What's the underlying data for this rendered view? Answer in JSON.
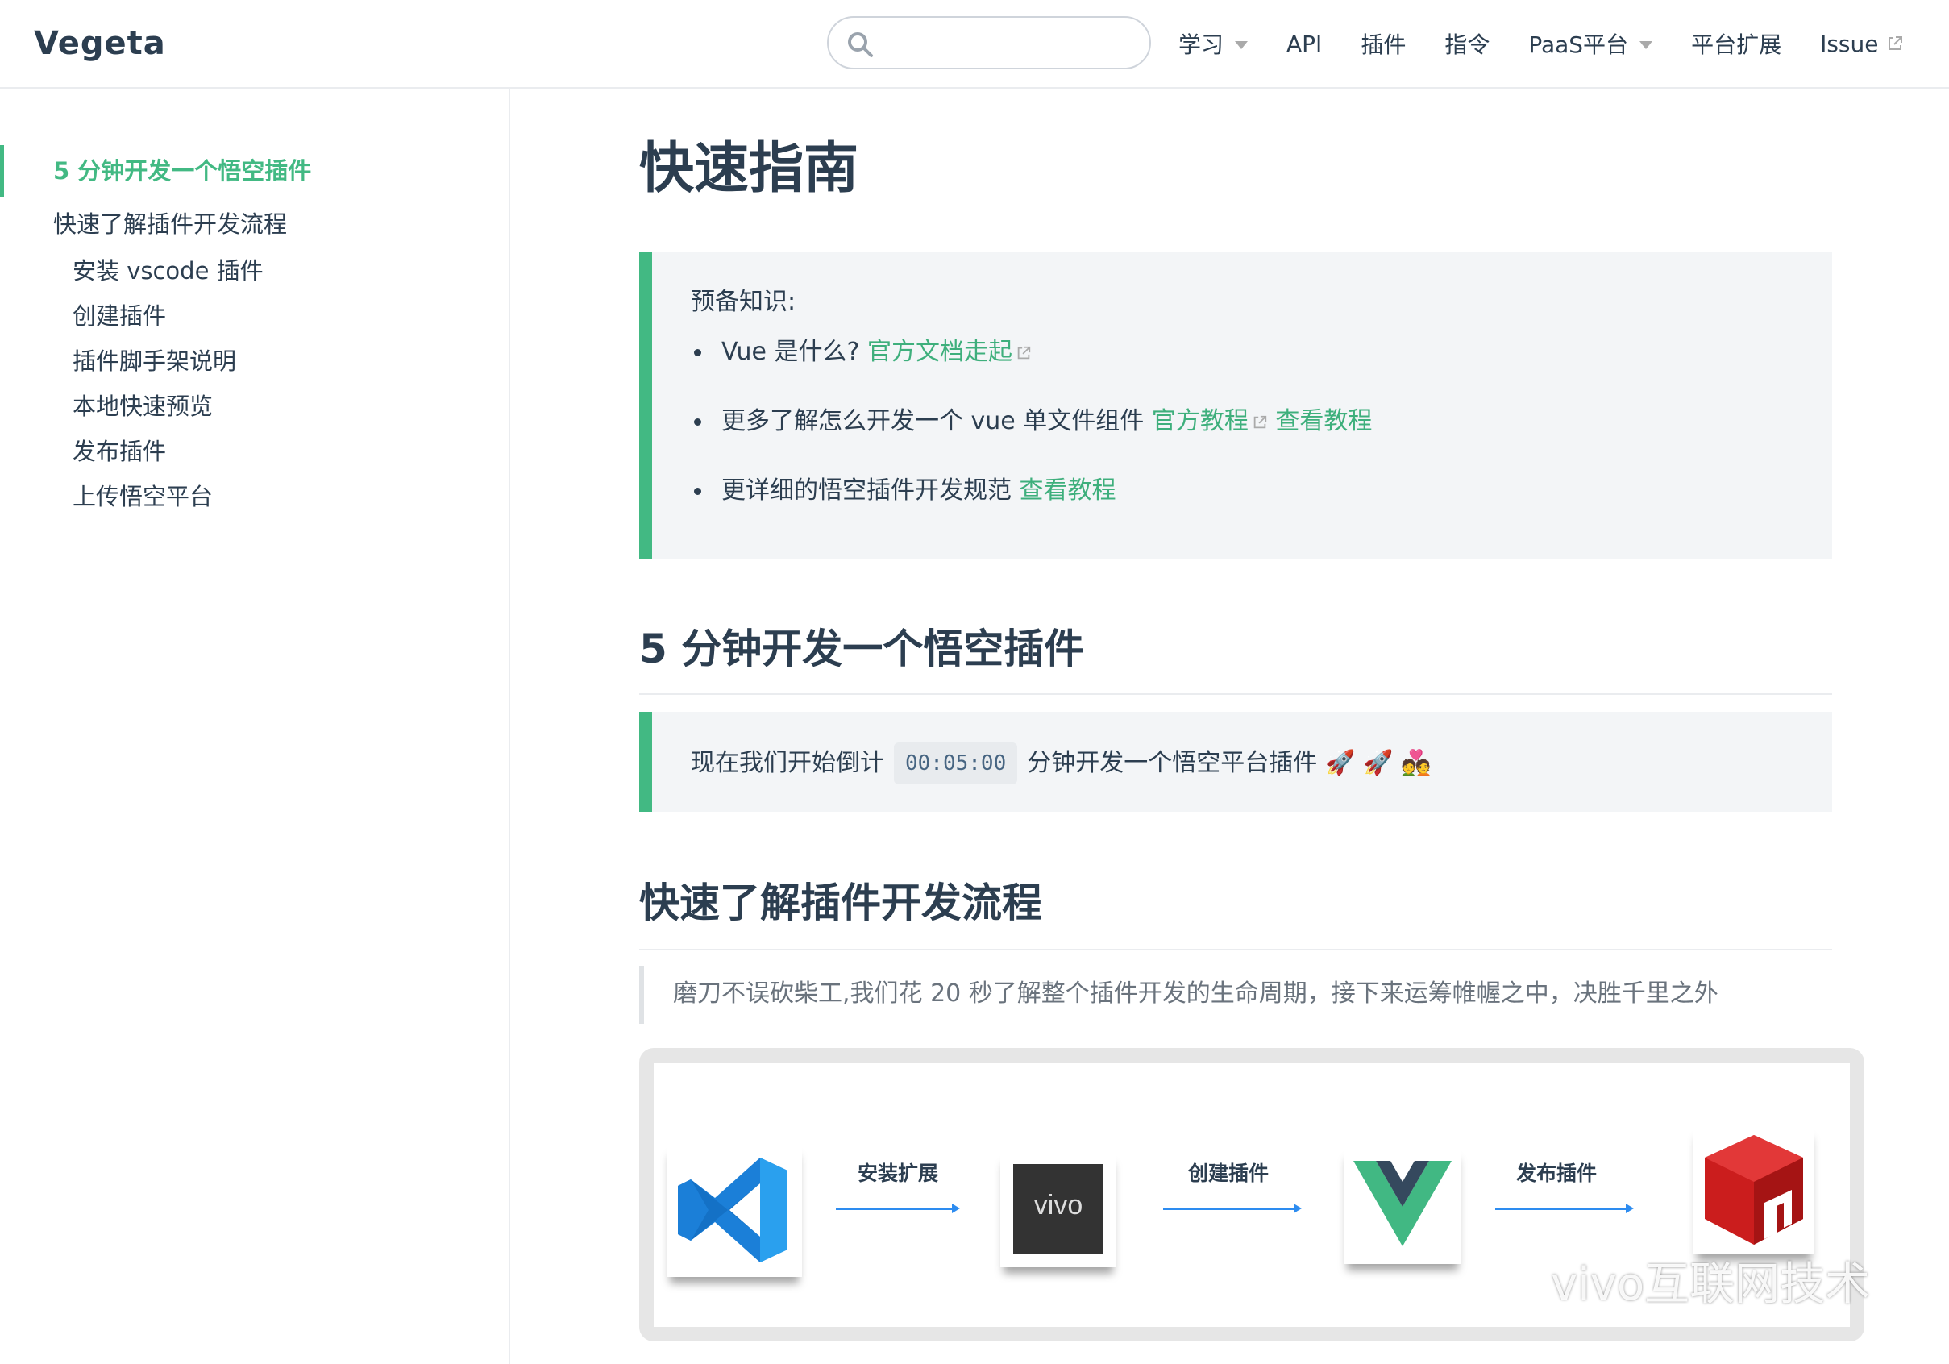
{
  "navbar": {
    "site_title": "Vegeta",
    "search": {
      "placeholder": ""
    },
    "links": [
      {
        "label": "学习",
        "dropdown": true
      },
      {
        "label": "API"
      },
      {
        "label": "插件"
      },
      {
        "label": "指令"
      },
      {
        "label": "PaaS平台",
        "dropdown": true
      },
      {
        "label": "平台扩展"
      },
      {
        "label": "Issue",
        "external": true
      }
    ]
  },
  "sidebar": {
    "items": [
      {
        "label": "5 分钟开发一个悟空插件",
        "active": true
      },
      {
        "label": "快速了解插件开发流程"
      },
      {
        "label": "安装 vscode 插件"
      },
      {
        "label": "创建插件"
      },
      {
        "label": "插件脚手架说明"
      },
      {
        "label": "本地快速预览"
      },
      {
        "label": "发布插件"
      },
      {
        "label": "上传悟空平台"
      }
    ]
  },
  "main": {
    "page_title": "快速指南",
    "prereq": {
      "title": "预备知识:",
      "items": [
        {
          "text": "Vue 是什么? ",
          "link1": "官方文档走起"
        },
        {
          "text": "更多了解怎么开发一个 vue 单文件组件 ",
          "link1": "官方教程",
          "link2": "查看教程"
        },
        {
          "text": "更详细的悟空插件开发规范 ",
          "link1": "查看教程"
        }
      ]
    },
    "section1": {
      "heading": "5 分钟开发一个悟空插件",
      "tip_before": "现在我们开始倒计",
      "tip_code": "00:05:00",
      "tip_after": "分钟开发一个悟空平台插件",
      "tip_emoji": "🚀 🚀 💑"
    },
    "section2": {
      "heading": "快速了解插件开发流程",
      "quote": "磨刀不误砍柴工,我们花 20 秒了解整个插件开发的生命周期，接下来运筹帷幄之中，决胜千里之外"
    },
    "flow": {
      "steps": [
        "安装扩展",
        "创建插件",
        "发布插件"
      ],
      "vivo_logo_text": "vivo"
    }
  },
  "watermark": {
    "text": "vivo互联网技术",
    "icon": "wechat-icon"
  },
  "colors": {
    "accent": "#42b983",
    "link": "#3eaf7c",
    "text": "#2c3e50",
    "tip_bg": "#f3f5f7"
  }
}
